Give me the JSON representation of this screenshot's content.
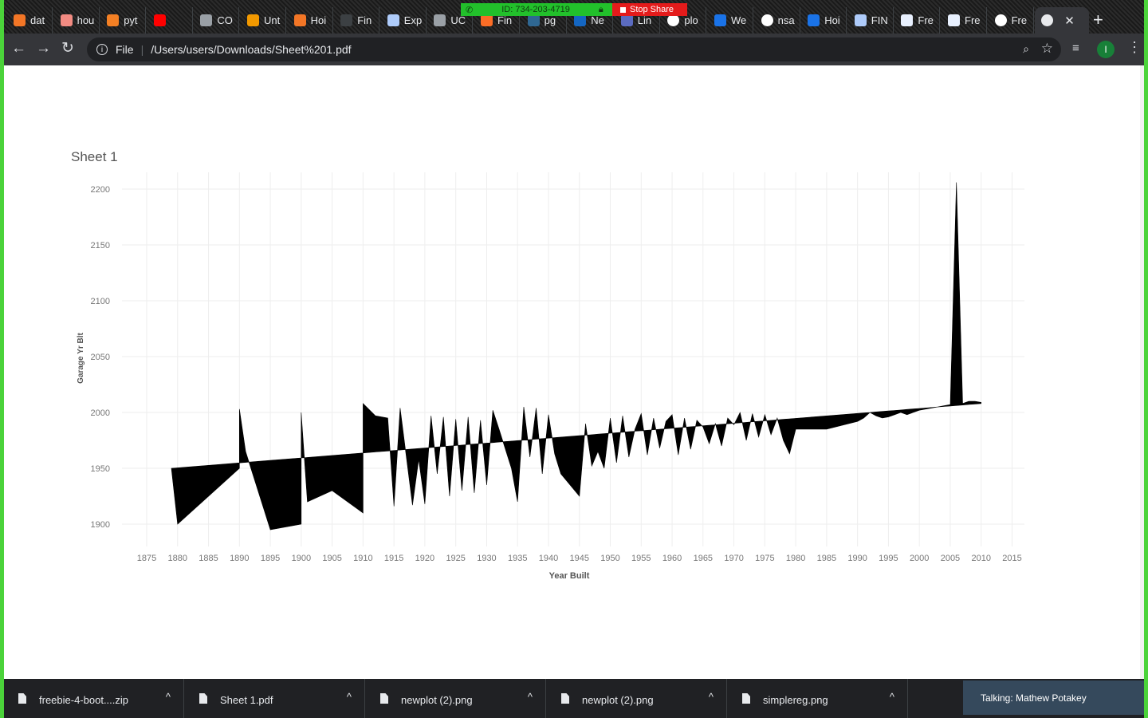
{
  "tabs": [
    {
      "title": "dat",
      "icon": "jupyter-icon",
      "color": "#f37626"
    },
    {
      "title": "hou",
      "icon": "document-icon",
      "color": "#f28b82"
    },
    {
      "title": "pyt",
      "icon": "stackoverflow-icon",
      "color": "#f48024"
    },
    {
      "title": "",
      "icon": "youtube-icon",
      "color": "#ff0000"
    },
    {
      "title": "CO",
      "icon": "github-icon",
      "color": "#9aa0a6"
    },
    {
      "title": "Unt",
      "icon": "notebook-icon",
      "color": "#f29900"
    },
    {
      "title": "Hoi",
      "icon": "jupyter-icon",
      "color": "#f37626"
    },
    {
      "title": "Fin",
      "icon": "blank-icon",
      "color": "#3c4043"
    },
    {
      "title": "Exp",
      "icon": "tableau-icon",
      "color": "#aecbfa"
    },
    {
      "title": "UC",
      "icon": "github-icon",
      "color": "#9aa0a6"
    },
    {
      "title": "Fin",
      "icon": "gitlab-icon",
      "color": "#fc6d26"
    },
    {
      "title": "pg",
      "icon": "pg-icon",
      "color": "#2f6792"
    },
    {
      "title": "Ne",
      "icon": "crunchbase-icon",
      "color": "#1466c2"
    },
    {
      "title": "Lin",
      "icon": "chart-icon",
      "color": "#5b6bc0"
    },
    {
      "title": "plo",
      "icon": "google-icon",
      "color": "#ffffff"
    },
    {
      "title": "We",
      "icon": "chart-icon",
      "color": "#1a73e8"
    },
    {
      "title": "nsa",
      "icon": "google-icon",
      "color": "#ffffff"
    },
    {
      "title": "Hoi",
      "icon": "chart-icon",
      "color": "#1a73e8"
    },
    {
      "title": "FIN",
      "icon": "tableau-icon",
      "color": "#aecbfa"
    },
    {
      "title": "Fre",
      "icon": "code-icon",
      "color": "#e8f0fe"
    },
    {
      "title": "Fre",
      "icon": "code-icon",
      "color": "#e8f0fe"
    },
    {
      "title": "Fre",
      "icon": "globe-icon",
      "color": "#ffffff"
    }
  ],
  "active_tab": {
    "title": "",
    "icon": "globe-icon",
    "close": "✕"
  },
  "new_tab": "+",
  "screen_share": {
    "id": "ID: 734-203-4719",
    "stop": "Stop Share"
  },
  "toolbar": {
    "back": "←",
    "forward": "→",
    "reload": "↻",
    "info": "i",
    "file": "File",
    "url": "/Users/users/Downloads/Sheet%201.pdf",
    "zoom": "⌕",
    "star": "☆",
    "media": "≡",
    "profile": "I",
    "menu": "⋮"
  },
  "chart_data": {
    "type": "area",
    "title": "Sheet 1",
    "xlabel": "Year Built",
    "ylabel": "Garage Yr Blt",
    "xlim": [
      1871,
      2017
    ],
    "ylim": [
      1880,
      2215
    ],
    "xticks": [
      1875,
      1880,
      1885,
      1890,
      1895,
      1900,
      1905,
      1910,
      1915,
      1920,
      1925,
      1930,
      1935,
      1940,
      1945,
      1950,
      1955,
      1960,
      1965,
      1970,
      1975,
      1980,
      1985,
      1990,
      1995,
      2000,
      2005,
      2010,
      2015
    ],
    "yticks": [
      1900,
      1950,
      2000,
      2050,
      2100,
      2150,
      2200
    ],
    "grid": true,
    "fill_color": "#000000",
    "baseline": {
      "x": [
        1879,
        2010
      ],
      "y": [
        1950,
        2008
      ]
    },
    "series": [
      {
        "x": [
          1879,
          1880,
          1890,
          1890,
          1891,
          1895,
          1900,
          1900,
          1901,
          1905,
          1910,
          1910,
          1912,
          1914,
          1915,
          1916,
          1918,
          1919,
          1920,
          1921,
          1922,
          1923,
          1924,
          1925,
          1926,
          1927,
          1928,
          1929,
          1930,
          1931,
          1932,
          1934,
          1935,
          1936,
          1937,
          1938,
          1939,
          1940,
          1941,
          1942,
          1945,
          1946,
          1947,
          1948,
          1949,
          1950,
          1951,
          1952,
          1953,
          1954,
          1955,
          1956,
          1957,
          1958,
          1959,
          1960,
          1961,
          1962,
          1963,
          1964,
          1965,
          1966,
          1967,
          1968,
          1969,
          1970,
          1971,
          1972,
          1973,
          1974,
          1975,
          1976,
          1977,
          1978,
          1979,
          1980,
          1985,
          1990,
          1991,
          1992,
          1993,
          1994,
          1995,
          1996,
          1997,
          1998,
          1999,
          2000,
          2001,
          2002,
          2003,
          2004,
          2005,
          2006,
          2007,
          2008,
          2009,
          2010
        ],
        "y": [
          1950,
          1900,
          1950,
          2003,
          1965,
          1895,
          1900,
          2000,
          1920,
          1930,
          1910,
          2008,
          1997,
          1995,
          1916,
          2004,
          1917,
          1958,
          1918,
          1997,
          1945,
          1996,
          1925,
          1994,
          1930,
          1996,
          1928,
          1993,
          1935,
          2002,
          1985,
          1950,
          1920,
          2005,
          1960,
          2004,
          1945,
          1998,
          1963,
          1945,
          1925,
          1990,
          1952,
          1965,
          1950,
          1995,
          1955,
          1997,
          1960,
          1985,
          1999,
          1962,
          1995,
          1968,
          1992,
          1998,
          1962,
          1995,
          1967,
          1993,
          1987,
          1972,
          1990,
          1970,
          1995,
          1989,
          2000,
          1975,
          1999,
          1978,
          1998,
          1980,
          1995,
          1975,
          1963,
          1985,
          1985,
          1992,
          1995,
          2000,
          1997,
          1995,
          1996,
          1998,
          2000,
          1998,
          2000,
          2002,
          2003,
          2004,
          2005,
          2006,
          2007,
          2206,
          2008,
          2010,
          2010,
          2009
        ]
      }
    ]
  },
  "downloads": [
    {
      "name": "freebie-4-boot....zip",
      "chevron": "^"
    },
    {
      "name": "Sheet 1.pdf",
      "chevron": "^"
    },
    {
      "name": "newplot (2).png",
      "chevron": "^"
    },
    {
      "name": "newplot (2).png",
      "chevron": "^"
    },
    {
      "name": "simplereg.png",
      "chevron": "^"
    }
  ],
  "talking": "Talking: Mathew Potakey"
}
